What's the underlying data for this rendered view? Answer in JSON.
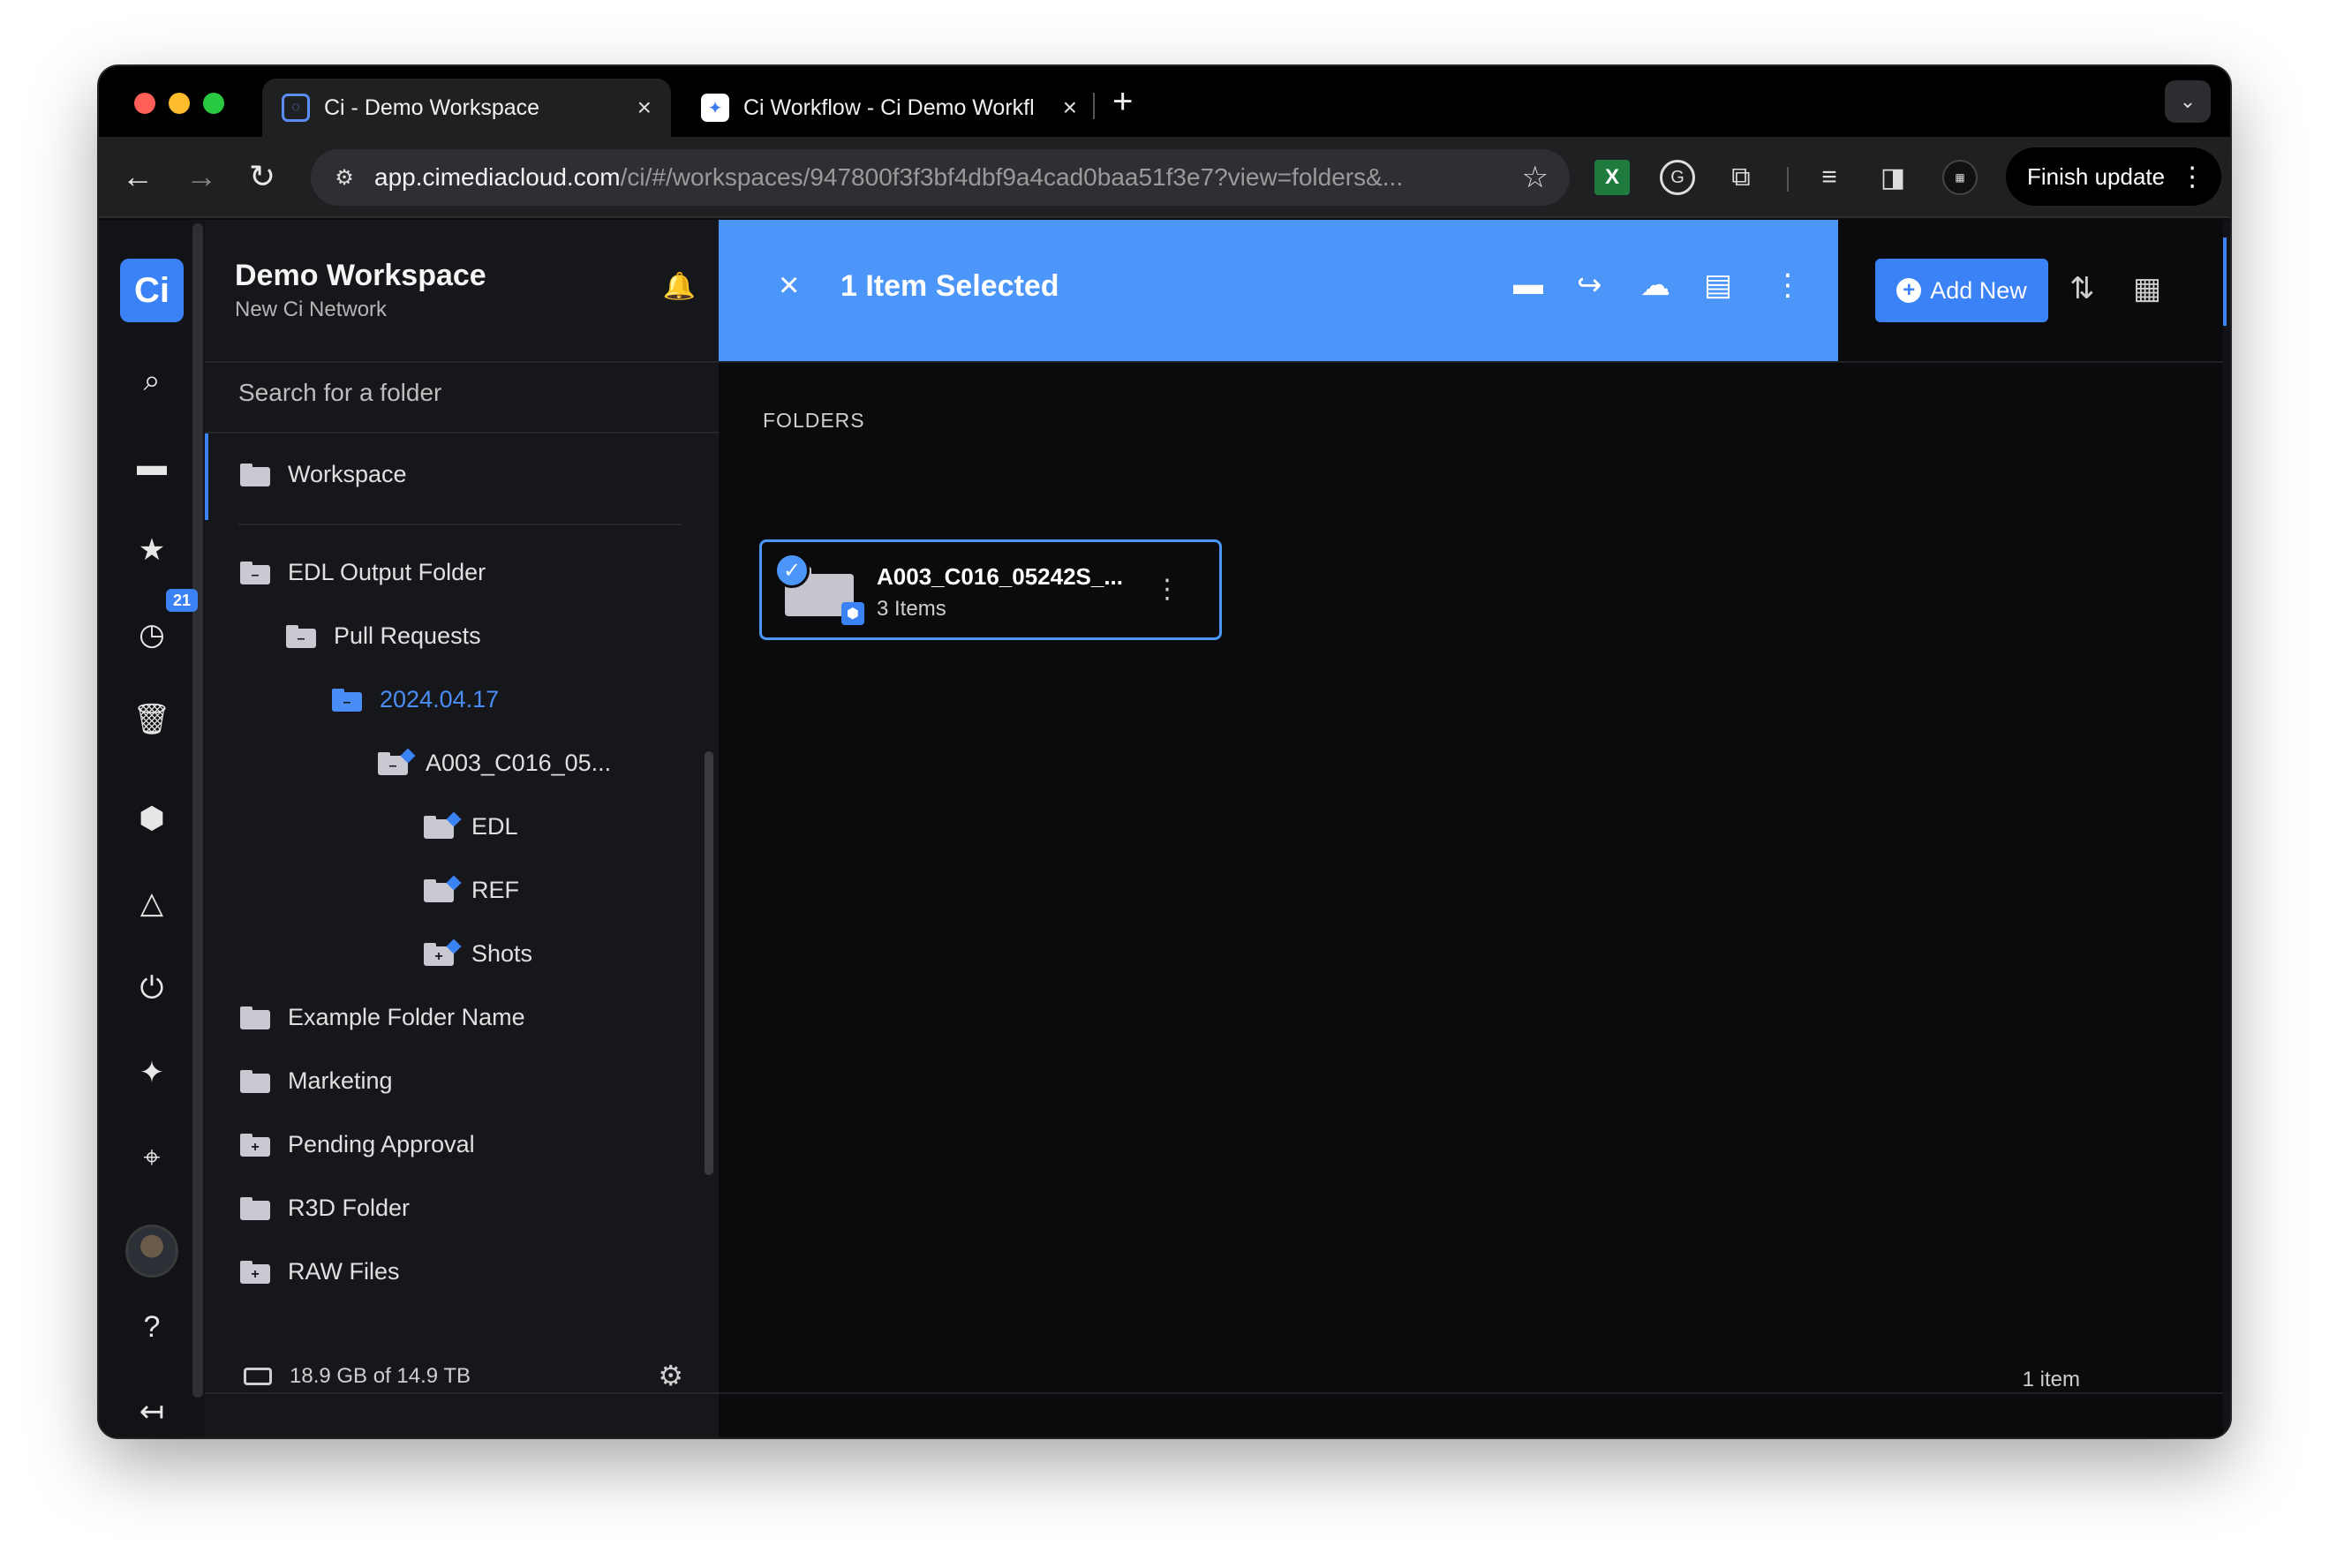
{
  "browser": {
    "tabs": [
      {
        "title": "Ci - Demo Workspace",
        "favicon": "ci-logo-icon"
      },
      {
        "title": "Ci Workflow - Ci Demo Workfl",
        "favicon": "workflow-icon"
      }
    ],
    "url_host": "app.cimediacloud.com",
    "url_path": "/ci/#/workspaces/947800f3f3bf4dbf9a4cad0baa51f3e7?view=folders&...",
    "finish_update": "Finish update"
  },
  "workspace": {
    "title": "Demo Workspace",
    "subtitle": "New Ci Network"
  },
  "rail": {
    "logo": "Ci",
    "history_badge": "21"
  },
  "sidebar": {
    "search_placeholder": "Search for a folder",
    "root": "Workspace",
    "tree": [
      {
        "label": "EDL Output Folder",
        "icon": "folder-minus-icon"
      },
      {
        "label": "Pull Requests",
        "icon": "folder-minus-icon"
      },
      {
        "label": "2024.04.17",
        "icon": "folder-minus-icon",
        "selected": true
      },
      {
        "label": "A003_C016_05...",
        "icon": "asset-folder-minus-icon"
      },
      {
        "label": "EDL",
        "icon": "asset-folder-icon"
      },
      {
        "label": "REF",
        "icon": "asset-folder-icon"
      },
      {
        "label": "Shots",
        "icon": "asset-folder-plus-icon"
      },
      {
        "label": "Example Folder Name",
        "icon": "folder-icon"
      },
      {
        "label": "Marketing",
        "icon": "folder-icon"
      },
      {
        "label": "Pending Approval",
        "icon": "folder-plus-icon"
      },
      {
        "label": "R3D Folder",
        "icon": "folder-icon"
      },
      {
        "label": "RAW Files",
        "icon": "folder-plus-icon"
      }
    ],
    "storage": "18.9 GB of 14.9 TB"
  },
  "selection_bar": {
    "text": "1 Item Selected"
  },
  "toolbar": {
    "add_new": "Add New"
  },
  "main": {
    "section_label": "FOLDERS",
    "folders": [
      {
        "name": "A003_C016_05242S_...",
        "count": "3 Items",
        "selected": true
      }
    ],
    "item_count": "1 item"
  },
  "colors": {
    "accent": "#4b96f8",
    "background": "#0b0b0d",
    "sidebar": "#16171b"
  }
}
